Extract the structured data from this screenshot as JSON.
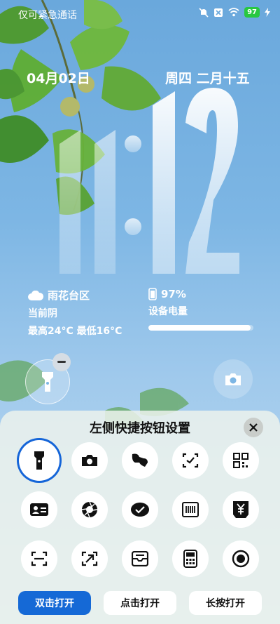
{
  "status_bar": {
    "left_text": "仅可紧急通话",
    "icons": [
      "mute-bell-icon",
      "no-sim-icon",
      "wifi-icon",
      "charging-icon"
    ],
    "battery_level": "97"
  },
  "lockscreen": {
    "date": "04月02日",
    "lunar_date": "周四 二月十五",
    "time": "11:12"
  },
  "weather": {
    "location": "雨花台区",
    "condition": "当前阴",
    "range": "最高24°C 最低16°C",
    "icon": "cloud-icon"
  },
  "device_battery": {
    "percent_text": "97%",
    "label": "设备电量",
    "level": 0.97
  },
  "shortcuts": {
    "left": "flashlight-icon",
    "right": "camera-icon"
  },
  "sheet": {
    "title": "左侧快捷按钮设置",
    "options": [
      "flashlight-icon",
      "camera-icon",
      "switch-icon",
      "checkbox-scan-icon",
      "qr-code-icon",
      "id-card-icon",
      "aperture-icon",
      "wechat-icon",
      "barcode-icon",
      "yen-note-icon",
      "scan-frame-icon",
      "send-arrow-icon",
      "inbox-icon",
      "calculator-icon",
      "record-icon"
    ],
    "selected_index": 0,
    "tabs": [
      "双击打开",
      "点击打开",
      "长按打开"
    ],
    "active_tab": 0
  },
  "colors": {
    "accent": "#1569d6",
    "battery_badge": "#28c840"
  }
}
